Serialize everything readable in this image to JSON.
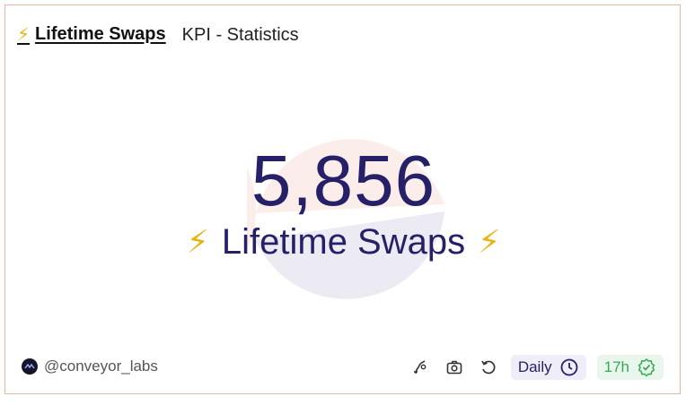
{
  "header": {
    "title_icon": "⚡",
    "title": "Lifetime Swaps",
    "subtitle": "KPI - Statistics"
  },
  "kpi": {
    "value": "5,856",
    "label": "Lifetime Swaps",
    "left_icon": "⚡",
    "right_icon": "⚡"
  },
  "footer": {
    "author": "@conveyor_labs",
    "schedule": "Daily",
    "freshness": "17h"
  },
  "colors": {
    "accent": "#252068",
    "border": "#eab6a0",
    "bolt": "#e7b416",
    "fresh_green": "#36a956"
  },
  "icons": {
    "title": "lightning-icon",
    "avatar": "conveyor-logo-icon",
    "fork": "fork-query-icon",
    "camera": "camera-icon",
    "refresh": "refresh-icon",
    "schedule": "clock-icon",
    "verified": "verified-check-icon"
  }
}
